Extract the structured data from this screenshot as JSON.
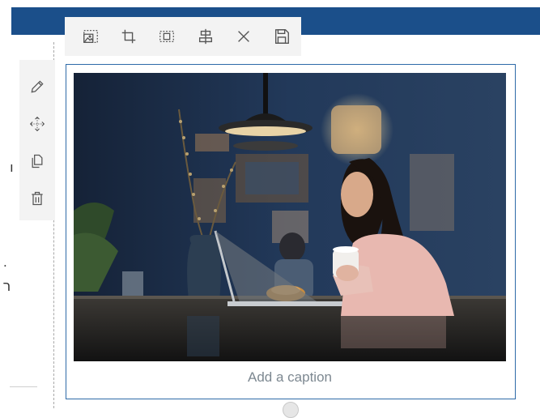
{
  "toolbar": {
    "items": [
      {
        "icon": "replace-image-icon",
        "label": "Replace image"
      },
      {
        "icon": "crop-icon",
        "label": "Crop"
      },
      {
        "icon": "fit-icon",
        "label": "Fit"
      },
      {
        "icon": "align-icon",
        "label": "Align"
      },
      {
        "icon": "close-icon",
        "label": "Close"
      },
      {
        "icon": "save-icon",
        "label": "Save"
      }
    ]
  },
  "side_toolbar": {
    "items": [
      {
        "icon": "pencil-icon",
        "label": "Edit"
      },
      {
        "icon": "move-icon",
        "label": "Move"
      },
      {
        "icon": "copy-icon",
        "label": "Duplicate"
      },
      {
        "icon": "trash-icon",
        "label": "Delete"
      }
    ]
  },
  "canvas": {
    "glyph_1": "ı",
    "glyph_2": ".",
    "glyph_3": "ר"
  },
  "image": {
    "caption_placeholder": "Add a caption",
    "accent_color": "#2e6aa8",
    "header_color": "#1b4f8a"
  }
}
